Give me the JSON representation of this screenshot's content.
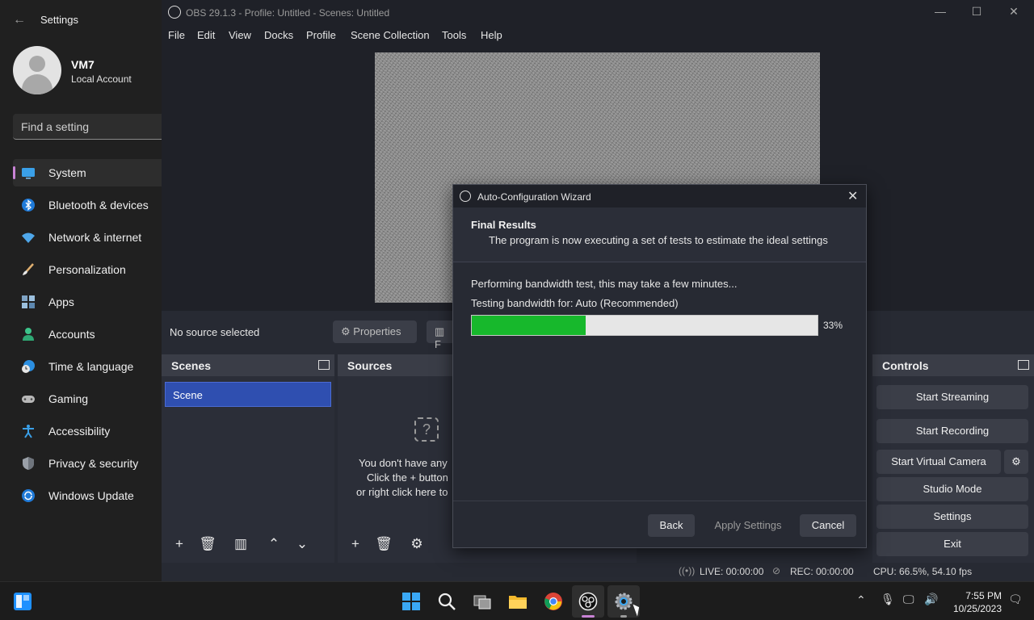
{
  "settings": {
    "title": "Settings",
    "user": {
      "name": "VM7",
      "type": "Local Account"
    },
    "search_placeholder": "Find a setting",
    "nav": [
      {
        "label": "System",
        "icon": "monitor-icon",
        "selected": true
      },
      {
        "label": "Bluetooth & devices",
        "icon": "bluetooth-icon"
      },
      {
        "label": "Network & internet",
        "icon": "wifi-icon"
      },
      {
        "label": "Personalization",
        "icon": "brush-icon"
      },
      {
        "label": "Apps",
        "icon": "apps-icon"
      },
      {
        "label": "Accounts",
        "icon": "person-icon"
      },
      {
        "label": "Time & language",
        "icon": "clock-globe-icon"
      },
      {
        "label": "Gaming",
        "icon": "gamepad-icon"
      },
      {
        "label": "Accessibility",
        "icon": "accessibility-icon"
      },
      {
        "label": "Privacy & security",
        "icon": "shield-icon"
      },
      {
        "label": "Windows Update",
        "icon": "update-icon"
      }
    ]
  },
  "obs": {
    "window_title": "OBS 29.1.3 - Profile: Untitled - Scenes: Untitled",
    "menu": [
      "File",
      "Edit",
      "View",
      "Docks",
      "Profile",
      "Scene Collection",
      "Tools",
      "Help"
    ],
    "no_source": "No source selected",
    "properties_label": "Properties",
    "filters_label": "F",
    "scenes": {
      "title": "Scenes",
      "items": [
        "Scene"
      ]
    },
    "sources": {
      "title": "Sources",
      "empty_lines": [
        "You don't have any",
        "Click the + button",
        "or right click here to"
      ]
    },
    "controls": {
      "title": "Controls",
      "start_streaming": "Start Streaming",
      "start_recording": "Start Recording",
      "start_virtual_camera": "Start Virtual Camera",
      "studio_mode": "Studio Mode",
      "settings": "Settings",
      "exit": "Exit"
    },
    "status": {
      "live": "LIVE: 00:00:00",
      "rec": "REC: 00:00:00",
      "cpu": "CPU: 66.5%, 54.10 fps"
    }
  },
  "wizard": {
    "title": "Auto-Configuration Wizard",
    "heading": "Final Results",
    "subheading": "The program is now executing a set of tests to estimate the ideal settings",
    "status_line": "Performing bandwidth test, this may take a few minutes...",
    "testing_line": "Testing bandwidth for: Auto (Recommended)",
    "progress": 0.33,
    "progress_label": "33%",
    "buttons": {
      "back": "Back",
      "apply": "Apply Settings",
      "cancel": "Cancel"
    },
    "progress_color": "#17b82c"
  },
  "taskbar": {
    "time": "7:55 PM",
    "date": "10/25/2023",
    "apps": [
      "start-icon",
      "search-icon",
      "task-view-icon",
      "file-explorer-icon",
      "chrome-icon",
      "obs-icon",
      "settings-gear-icon"
    ]
  }
}
